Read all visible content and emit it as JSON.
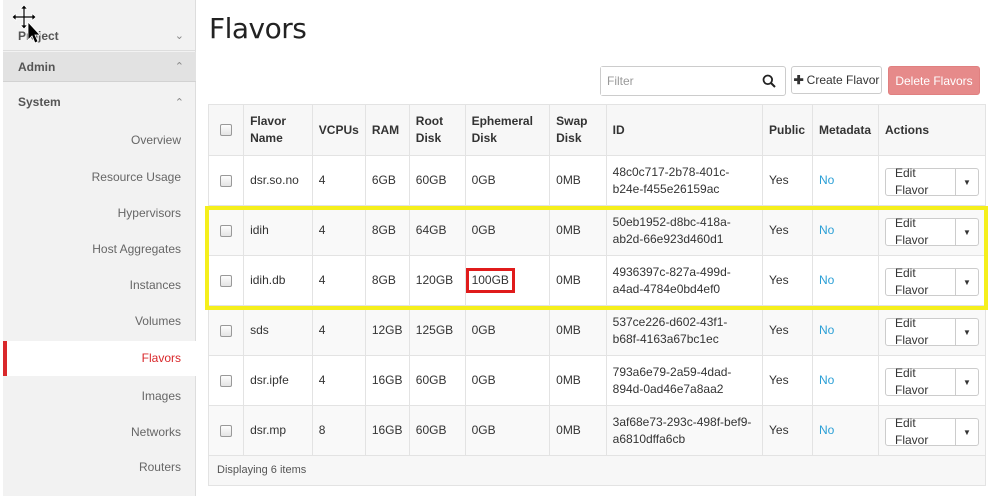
{
  "sidebar": {
    "project_label": "Project",
    "admin_label": "Admin",
    "system_label": "System",
    "chevron_up": "⌃",
    "chevron_down": "⌄",
    "links": [
      {
        "label": "Overview",
        "active": false
      },
      {
        "label": "Resource Usage",
        "active": false
      },
      {
        "label": "Hypervisors",
        "active": false
      },
      {
        "label": "Host Aggregates",
        "active": false
      },
      {
        "label": "Instances",
        "active": false
      },
      {
        "label": "Volumes",
        "active": false
      },
      {
        "label": "Flavors",
        "active": true
      },
      {
        "label": "Images",
        "active": false
      },
      {
        "label": "Networks",
        "active": false
      },
      {
        "label": "Routers",
        "active": false
      }
    ]
  },
  "page": {
    "title": "Flavors"
  },
  "toolbar": {
    "filter_placeholder": "Filter",
    "filter_value": "",
    "create_label": "Create Flavor",
    "delete_label": "Delete Flavors"
  },
  "table": {
    "headers": {
      "flavor_name": [
        "Flavor",
        "Name"
      ],
      "vcpus": "VCPUs",
      "ram": "RAM",
      "root_disk": [
        "Root",
        "Disk"
      ],
      "ephemeral_disk": [
        "Ephemeral",
        "Disk"
      ],
      "swap_disk": [
        "Swap",
        "Disk"
      ],
      "id": "ID",
      "public": "Public",
      "metadata": "Metadata",
      "actions": "Actions"
    },
    "rows": [
      {
        "name": "dsr.so.no",
        "vcpus": "4",
        "ram": "6GB",
        "root": "60GB",
        "eph": "0GB",
        "swap": "0MB",
        "id1": "48c0c717-2b78-401c-",
        "id2": "b24e-f455e26159ac",
        "public": "Yes",
        "metadata": "No",
        "action": "Edit Flavor"
      },
      {
        "name": "idih",
        "vcpus": "4",
        "ram": "8GB",
        "root": "64GB",
        "eph": "0GB",
        "swap": "0MB",
        "id1": "50eb1952-d8bc-418a-",
        "id2": "ab2d-66e923d460d1",
        "public": "Yes",
        "metadata": "No",
        "action": "Edit Flavor"
      },
      {
        "name": "idih.db",
        "vcpus": "4",
        "ram": "8GB",
        "root": "120GB",
        "eph": "100GB",
        "swap": "0MB",
        "id1": "4936397c-827a-499d-",
        "id2": "a4ad-4784e0bd4ef0",
        "public": "Yes",
        "metadata": "No",
        "action": "Edit Flavor"
      },
      {
        "name": "sds",
        "vcpus": "4",
        "ram": "12GB",
        "root": "125GB",
        "eph": "0GB",
        "swap": "0MB",
        "id1": "537ce226-d602-43f1-",
        "id2": "b68f-4163a67bc1ec",
        "public": "Yes",
        "metadata": "No",
        "action": "Edit Flavor"
      },
      {
        "name": "dsr.ipfe",
        "vcpus": "4",
        "ram": "16GB",
        "root": "60GB",
        "eph": "0GB",
        "swap": "0MB",
        "id1": "793a6e79-2a59-4dad-",
        "id2": "894d-0ad46e7a8aa2",
        "public": "Yes",
        "metadata": "No",
        "action": "Edit Flavor"
      },
      {
        "name": "dsr.mp",
        "vcpus": "8",
        "ram": "16GB",
        "root": "60GB",
        "eph": "0GB",
        "swap": "0MB",
        "id1": "3af68e73-293c-498f-bef9-",
        "id2": "a6810dffa6cb",
        "public": "Yes",
        "metadata": "No",
        "action": "Edit Flavor"
      }
    ],
    "footer": "Displaying 6 items"
  },
  "highlights": {
    "yellow_color": "#f5ef1c",
    "red_color": "#e01b1b"
  }
}
